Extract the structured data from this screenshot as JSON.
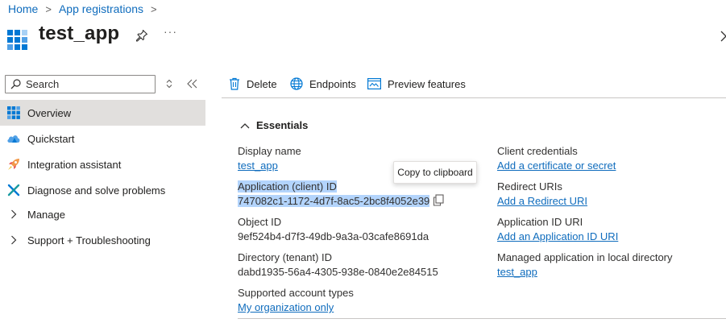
{
  "breadcrumb": {
    "items": [
      {
        "label": "Home"
      },
      {
        "label": "App registrations"
      }
    ],
    "separator": ">"
  },
  "header": {
    "title": "test_app",
    "more_label": "···"
  },
  "sidebar": {
    "search": {
      "placeholder": "Search"
    },
    "items": [
      {
        "label": "Overview",
        "icon": "overview-grid-icon",
        "active": true
      },
      {
        "label": "Quickstart",
        "icon": "quickstart-cloud-icon"
      },
      {
        "label": "Integration assistant",
        "icon": "rocket-icon"
      },
      {
        "label": "Diagnose and solve problems",
        "icon": "wrench-icon"
      },
      {
        "label": "Manage",
        "icon": "chevron-right-icon"
      },
      {
        "label": "Support + Troubleshooting",
        "icon": "chevron-right-icon"
      }
    ]
  },
  "toolbar": {
    "delete_label": "Delete",
    "endpoints_label": "Endpoints",
    "preview_label": "Preview features"
  },
  "essentials": {
    "title": "Essentials",
    "left": [
      {
        "label": "Display name",
        "value": "test_app",
        "is_link": true
      },
      {
        "label": "Application (client) ID",
        "value": "747082c1-1172-4d7f-8ac5-2bc8f4052e39",
        "is_link": false
      },
      {
        "label": "Object ID",
        "value": "9ef524b4-d7f3-49db-9a3a-03cafe8691da",
        "is_link": false
      },
      {
        "label": "Directory (tenant) ID",
        "value": "dabd1935-56a4-4305-938e-0840e2e84515",
        "is_link": false
      },
      {
        "label": "Supported account types",
        "value": "My organization only",
        "is_link": true
      }
    ],
    "right": [
      {
        "label": "Client credentials",
        "value": "Add a certificate or secret"
      },
      {
        "label": "Redirect URIs",
        "value": "Add a Redirect URI"
      },
      {
        "label": "Application ID URI",
        "value": "Add an Application ID URI"
      },
      {
        "label": "Managed application in local directory",
        "value": "test_app"
      }
    ]
  },
  "tooltip": {
    "text": "Copy to clipboard"
  },
  "colors": {
    "link": "#0f6cbd",
    "active_bg": "#e1dfdd",
    "selection": "#b3d4fc"
  }
}
